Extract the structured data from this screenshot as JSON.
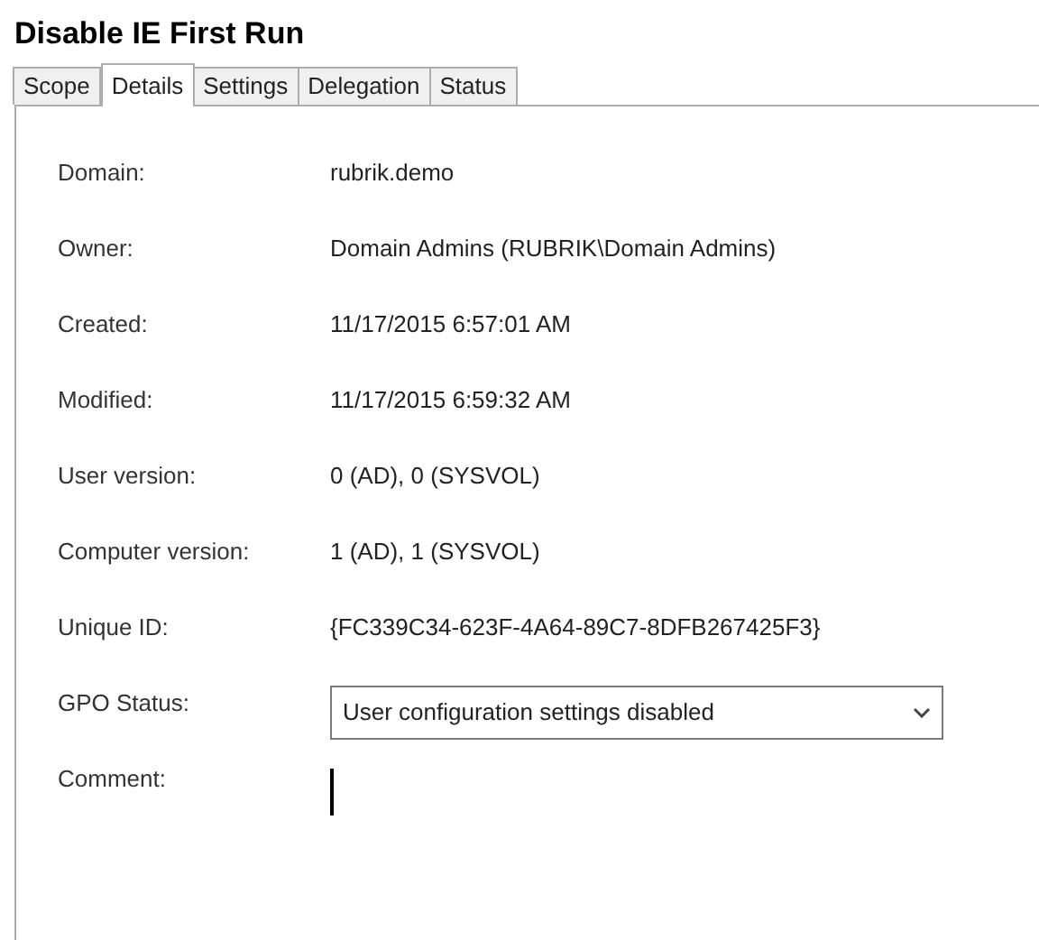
{
  "title": "Disable IE First Run",
  "tabs": [
    {
      "label": "Scope",
      "selected": false
    },
    {
      "label": "Details",
      "selected": true
    },
    {
      "label": "Settings",
      "selected": false
    },
    {
      "label": "Delegation",
      "selected": false
    },
    {
      "label": "Status",
      "selected": false
    }
  ],
  "fields": [
    {
      "kind": "text",
      "label": "Domain:",
      "value": "rubrik.demo"
    },
    {
      "kind": "text",
      "label": "Owner:",
      "value": "Domain Admins (RUBRIK\\Domain Admins)"
    },
    {
      "kind": "text",
      "label": "Created:",
      "value": "11/17/2015 6:57:01 AM"
    },
    {
      "kind": "text",
      "label": "Modified:",
      "value": "11/17/2015 6:59:32 AM"
    },
    {
      "kind": "text",
      "label": "User version:",
      "value": "0 (AD), 0 (SYSVOL)"
    },
    {
      "kind": "text",
      "label": "Computer version:",
      "value": "1 (AD), 1 (SYSVOL)"
    },
    {
      "kind": "text",
      "label": "Unique ID:",
      "value": "{FC339C34-623F-4A64-89C7-8DFB267425F3}"
    },
    {
      "kind": "dropdown",
      "label": "GPO Status:",
      "value": "User configuration settings disabled"
    },
    {
      "kind": "input",
      "label": "Comment:"
    }
  ]
}
